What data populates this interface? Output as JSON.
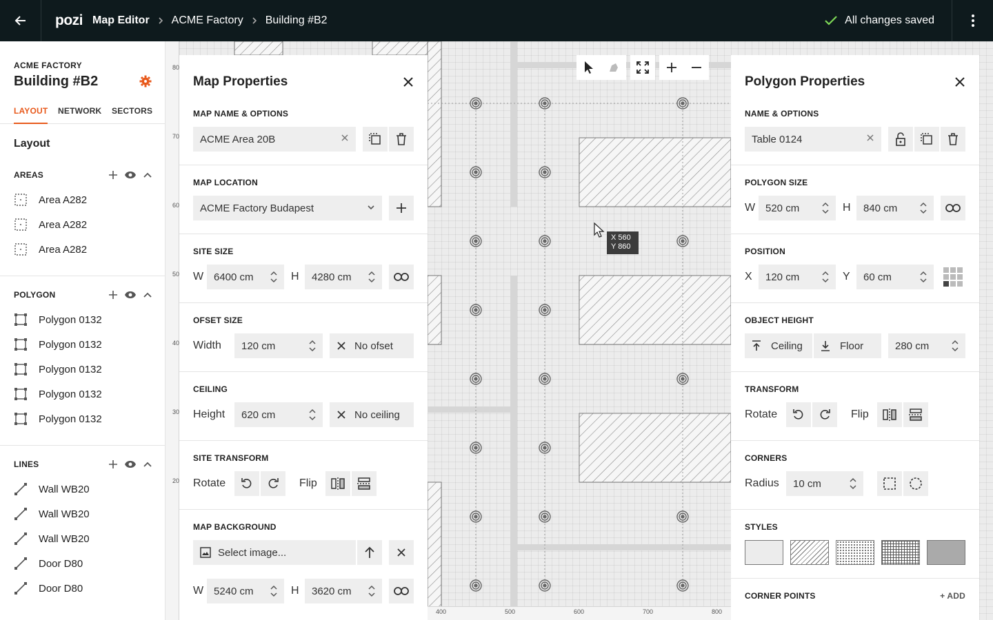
{
  "topbar": {
    "logo": "pozi",
    "app_name": "Map Editor",
    "breadcrumb": [
      "ACME Factory",
      "Building #B2"
    ],
    "status": "All changes saved"
  },
  "sidebar": {
    "project": "ACME FACTORY",
    "title": "Building #B2",
    "tabs": [
      "LAYOUT",
      "NETWORK",
      "SECTORS"
    ],
    "active_tab": "LAYOUT",
    "section_title": "Layout",
    "areas": {
      "label": "AREAS",
      "items": [
        "Area A282",
        "Area A282",
        "Area A282"
      ]
    },
    "polygons": {
      "label": "POLYGON",
      "items": [
        "Polygon 0132",
        "Polygon 0132",
        "Polygon 0132",
        "Polygon 0132",
        "Polygon 0132"
      ]
    },
    "lines": {
      "label": "LINES",
      "items": [
        "Wall WB20",
        "Wall WB20",
        "Wall WB20",
        "Door D80",
        "Door D80"
      ]
    }
  },
  "canvas": {
    "ruler_left": [
      "80",
      "70",
      "60",
      "50",
      "40",
      "30",
      "20"
    ],
    "ruler_bottom": [
      "400",
      "500",
      "600",
      "700",
      "800"
    ],
    "cursor_readout": {
      "x": "X 560",
      "y": "Y 860"
    }
  },
  "map_properties": {
    "title": "Map Properties",
    "name_label": "MAP NAME & OPTIONS",
    "name_value": "ACME Area 20B",
    "location_label": "MAP LOCATION",
    "location_value": "ACME Factory Budapest",
    "site_size_label": "SITE SIZE",
    "site_w_label": "W",
    "site_w": "6400 cm",
    "site_h_label": "H",
    "site_h": "4280 cm",
    "offset_label": "OFSET SIZE",
    "offset_width_label": "Width",
    "offset_width": "120 cm",
    "offset_none": "No ofset",
    "ceiling_label": "CEILING",
    "ceiling_height_label": "Height",
    "ceiling_height": "620 cm",
    "ceiling_none": "No ceiling",
    "transform_label": "SITE TRANSFORM",
    "rotate_label": "Rotate",
    "flip_label": "Flip",
    "background_label": "MAP BACKGROUND",
    "background_placeholder": "Select image...",
    "bg_w_label": "W",
    "bg_w": "5240 cm",
    "bg_h_label": "H",
    "bg_h": "3620 cm"
  },
  "polygon_properties": {
    "title": "Polygon Properties",
    "name_label": "NAME & OPTIONS",
    "name_value": "Table 0124",
    "size_label": "POLYGON SIZE",
    "w_label": "W",
    "w": "520 cm",
    "h_label": "H",
    "h": "840 cm",
    "position_label": "POSITION",
    "x_label": "X",
    "x": "120 cm",
    "y_label": "Y",
    "y": "60 cm",
    "height_label": "OBJECT HEIGHT",
    "ceiling": "Ceiling",
    "floor": "Floor",
    "height_value": "280 cm",
    "transform_label": "TRANSFORM",
    "rotate_label": "Rotate",
    "flip_label": "Flip",
    "corners_label": "CORNERS",
    "radius_label": "Radius",
    "radius": "10 cm",
    "styles_label": "STYLES",
    "corner_points_label": "CORNER POINTS",
    "add_label": "+ ADD"
  },
  "colors": {
    "accent": "#e8591b",
    "topbar": "#0e1a1d",
    "saved_check": "#7ed957"
  }
}
